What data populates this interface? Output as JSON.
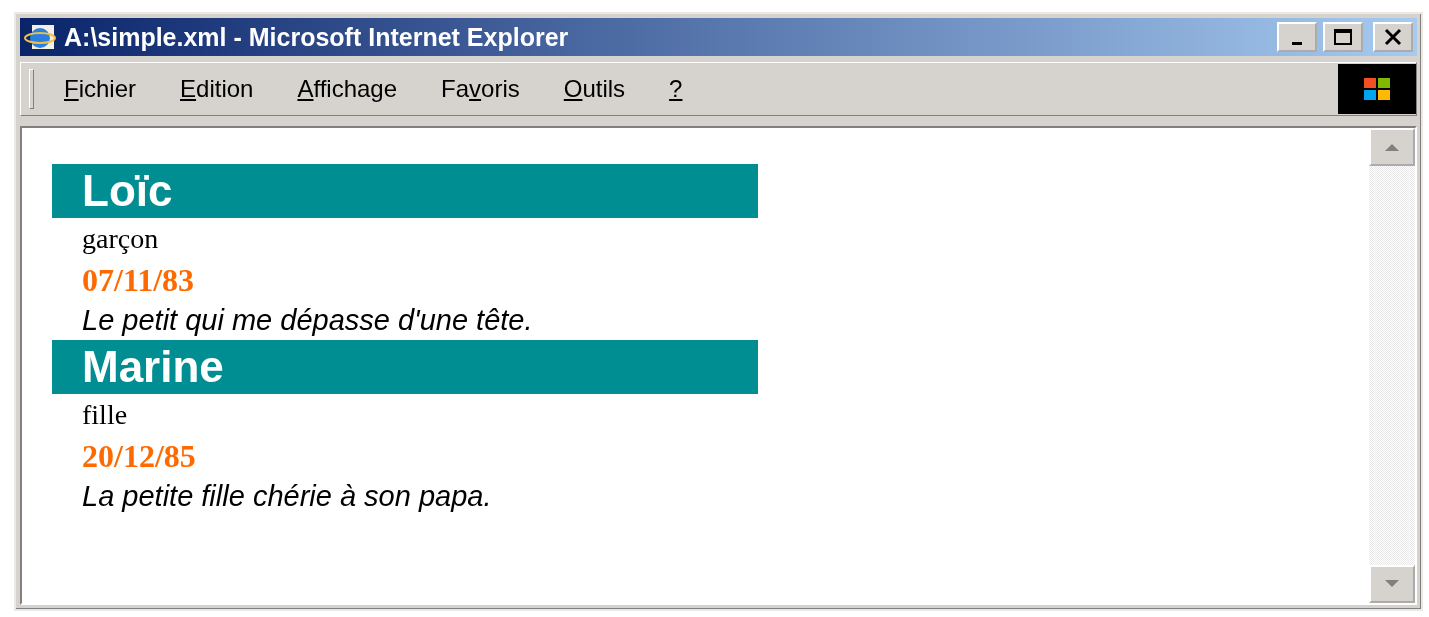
{
  "window": {
    "title": "A:\\simple.xml - Microsoft Internet Explorer"
  },
  "menu": [
    {
      "mnemonic": "F",
      "after": "ichier"
    },
    {
      "mnemonic": "E",
      "after": "dition"
    },
    {
      "mnemonic": "A",
      "after": "ffichage"
    },
    {
      "before": "Fa",
      "mnemonic": "v",
      "after": "oris"
    },
    {
      "mnemonic": "O",
      "after": "utils"
    },
    {
      "mnemonic": "?"
    }
  ],
  "people": [
    {
      "name": "Loïc",
      "gender": "garçon",
      "date": "07/11/83",
      "comment": "Le petit qui me dépasse d'une tête."
    },
    {
      "name": "Marine",
      "gender": "fille",
      "date": "20/12/85",
      "comment": "La petite fille chérie à son papa."
    }
  ]
}
